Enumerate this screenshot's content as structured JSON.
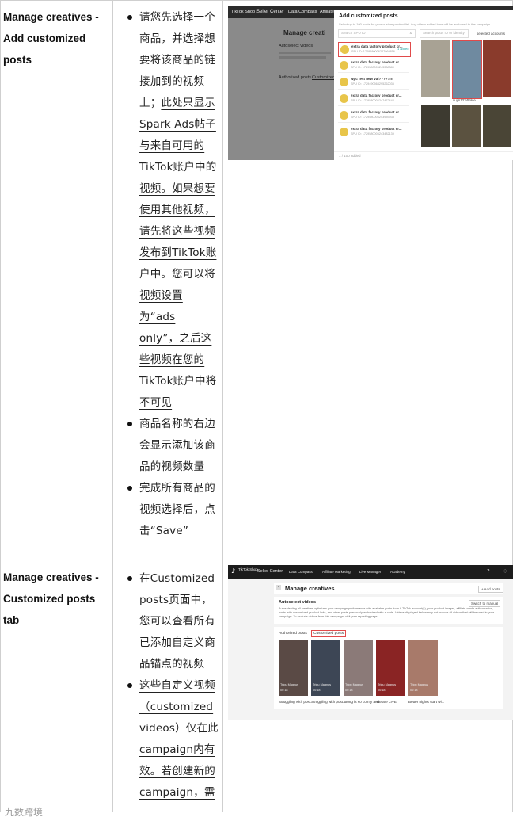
{
  "rows": [
    {
      "title": "Manage creatives - Add customized posts",
      "bullets": [
        {
          "parts": [
            {
              "text": "请您先选择一个商品，并选择想要将该商品的链接加到的视频上；",
              "u": false
            },
            {
              "text": "此处只显示Spark Ads帖子与来自可用的TikTok账户中的视频。如果想要使用其他视频，请先将这些视频发布到TikTok账户中。您可以将视频设置为“ads only”，之后这些视频在您的TikTok账户中将不可见",
              "u": true
            }
          ]
        },
        {
          "parts": [
            {
              "text": "商品名称的右边会显示添加该商品的视频数量",
              "u": false
            }
          ]
        },
        {
          "parts": [
            {
              "text": "完成所有商品的视频选择后，点击“Save”",
              "u": false
            }
          ]
        }
      ],
      "screenshot": {
        "header": "TikTok Shop",
        "nav_seller": "Seller Center",
        "nav_compass": "Data Compass",
        "nav_affiliate": "Affiliate Marketing",
        "bg_title": "Manage creati",
        "bg_autoselect": "Autoselect videos",
        "bg_authorized": "Authorized posts",
        "bg_customized": "Customized",
        "modal_title": "Add customized posts",
        "modal_sub": "Select up to 100 posts for your custom product list. Any videos added here will be anchored to the campaign.",
        "search_left": "Search SPU ID",
        "search_right": "Search posts ID or identity",
        "accounts": "selected accounts",
        "products": [
          {
            "name": "extra data factory product cr...",
            "id": "SPU ID: 1729580006247068856",
            "badge": "1 added"
          },
          {
            "name": "extra data factory product cr...",
            "id": "SPU ID: 1729580006243338380",
            "badge": ""
          },
          {
            "name": "wpc test new val?????!!!",
            "id": "SPU ID: 1729490564295262035",
            "badge": ""
          },
          {
            "name": "extra data factory product cr...",
            "id": "SPU ID: 1729580006247472442",
            "badge": ""
          },
          {
            "name": "extra data factory product cr...",
            "id": "SPU ID: 1729580006243939938",
            "badge": ""
          },
          {
            "name": "extra data factory product cr...",
            "id": "SPU ID: 1729580006243482139",
            "badge": ""
          }
        ],
        "video_label": "sujin1234trikle",
        "counter": "1 / 100 added"
      }
    },
    {
      "title": "Manage creatives - Customized posts tab",
      "bullets": [
        {
          "parts": [
            {
              "text": "在Customized posts页面中，您可以查看所有已添加自定义商品锚点的视频",
              "u": false
            }
          ]
        },
        {
          "parts": [
            {
              "text": "这些自定义视频（customized videos）仅在此campaign内有效。若创建新的campaign，需",
              "u": true
            }
          ]
        }
      ],
      "screenshot": {
        "logo": "TikTok Shop",
        "nav": [
          "Seller Center",
          "Data Compass",
          "Affiliate Marketing",
          "Live Manager",
          "Academy"
        ],
        "page_title": "Manage creatives",
        "add_button": "+ Add posts",
        "autoselect_title": "Autoselect videos",
        "switch_button": "Switch to manual",
        "autoselect_desc": "Autoselecting all creatives optimizes your campaign performance with available posts from 8 TikTok account(s), your product images, affiliate-made authorization, posts with customized product links, and other posts previously authorized with a code. Videos displayed below may not include all videos that will be used in your campaign. To exclude videos from this campaign, visit your reporting page.",
        "tab_authorized": "Authorized posts",
        "tab_customized": "Customized posts",
        "videos": [
          {
            "author": "Tripu Magnus",
            "duration": "00:18",
            "caption": "Struggling with post..."
          },
          {
            "author": "Tripu Magnus",
            "duration": "00:18",
            "caption": "Struggling with post..."
          },
          {
            "author": "Tripu Magnus",
            "duration": "00:18",
            "caption": "Wong is so comfy and..."
          },
          {
            "author": "Tripu Magnus",
            "duration": "00:18",
            "caption": "We are LIVE!"
          },
          {
            "author": "Tripu Magnus",
            "duration": "00:18",
            "caption": "Better nights start wi..."
          }
        ]
      }
    }
  ],
  "footer_logo": "九数跨境",
  "colors": {
    "highlight": "#e04a4a",
    "nav_dark": "#1c1c1c",
    "link_teal": "#1aa3a3"
  }
}
